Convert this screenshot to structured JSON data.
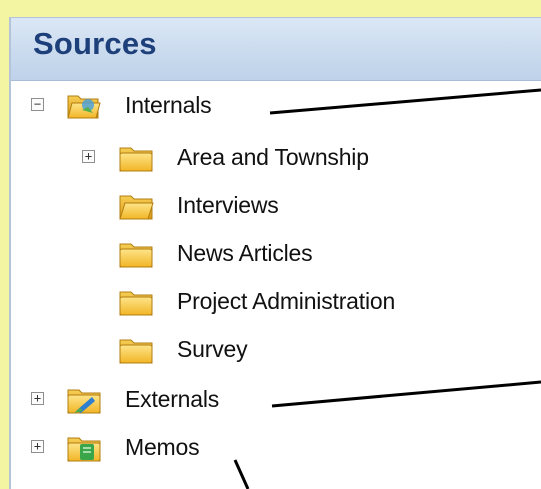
{
  "panel": {
    "title": "Sources"
  },
  "tree": [
    {
      "label": "Internals",
      "expander": "−"
    },
    {
      "label": "Area and Township",
      "expander": "+"
    },
    {
      "label": "Interviews"
    },
    {
      "label": "News Articles"
    },
    {
      "label": "Project Administration"
    },
    {
      "label": "Survey"
    },
    {
      "label": "Externals",
      "expander": "+"
    },
    {
      "label": "Memos",
      "expander": "+"
    }
  ],
  "icons": {
    "folder": "folder-icon",
    "folder_open": "folder-open-icon",
    "internals": "internals-folder-icon",
    "externals": "externals-folder-icon",
    "memos": "memos-folder-icon"
  },
  "colors": {
    "background": "#f4f5a2",
    "header": "#c9daee",
    "title": "#1d3f7a",
    "folder": "#f7c23a"
  }
}
